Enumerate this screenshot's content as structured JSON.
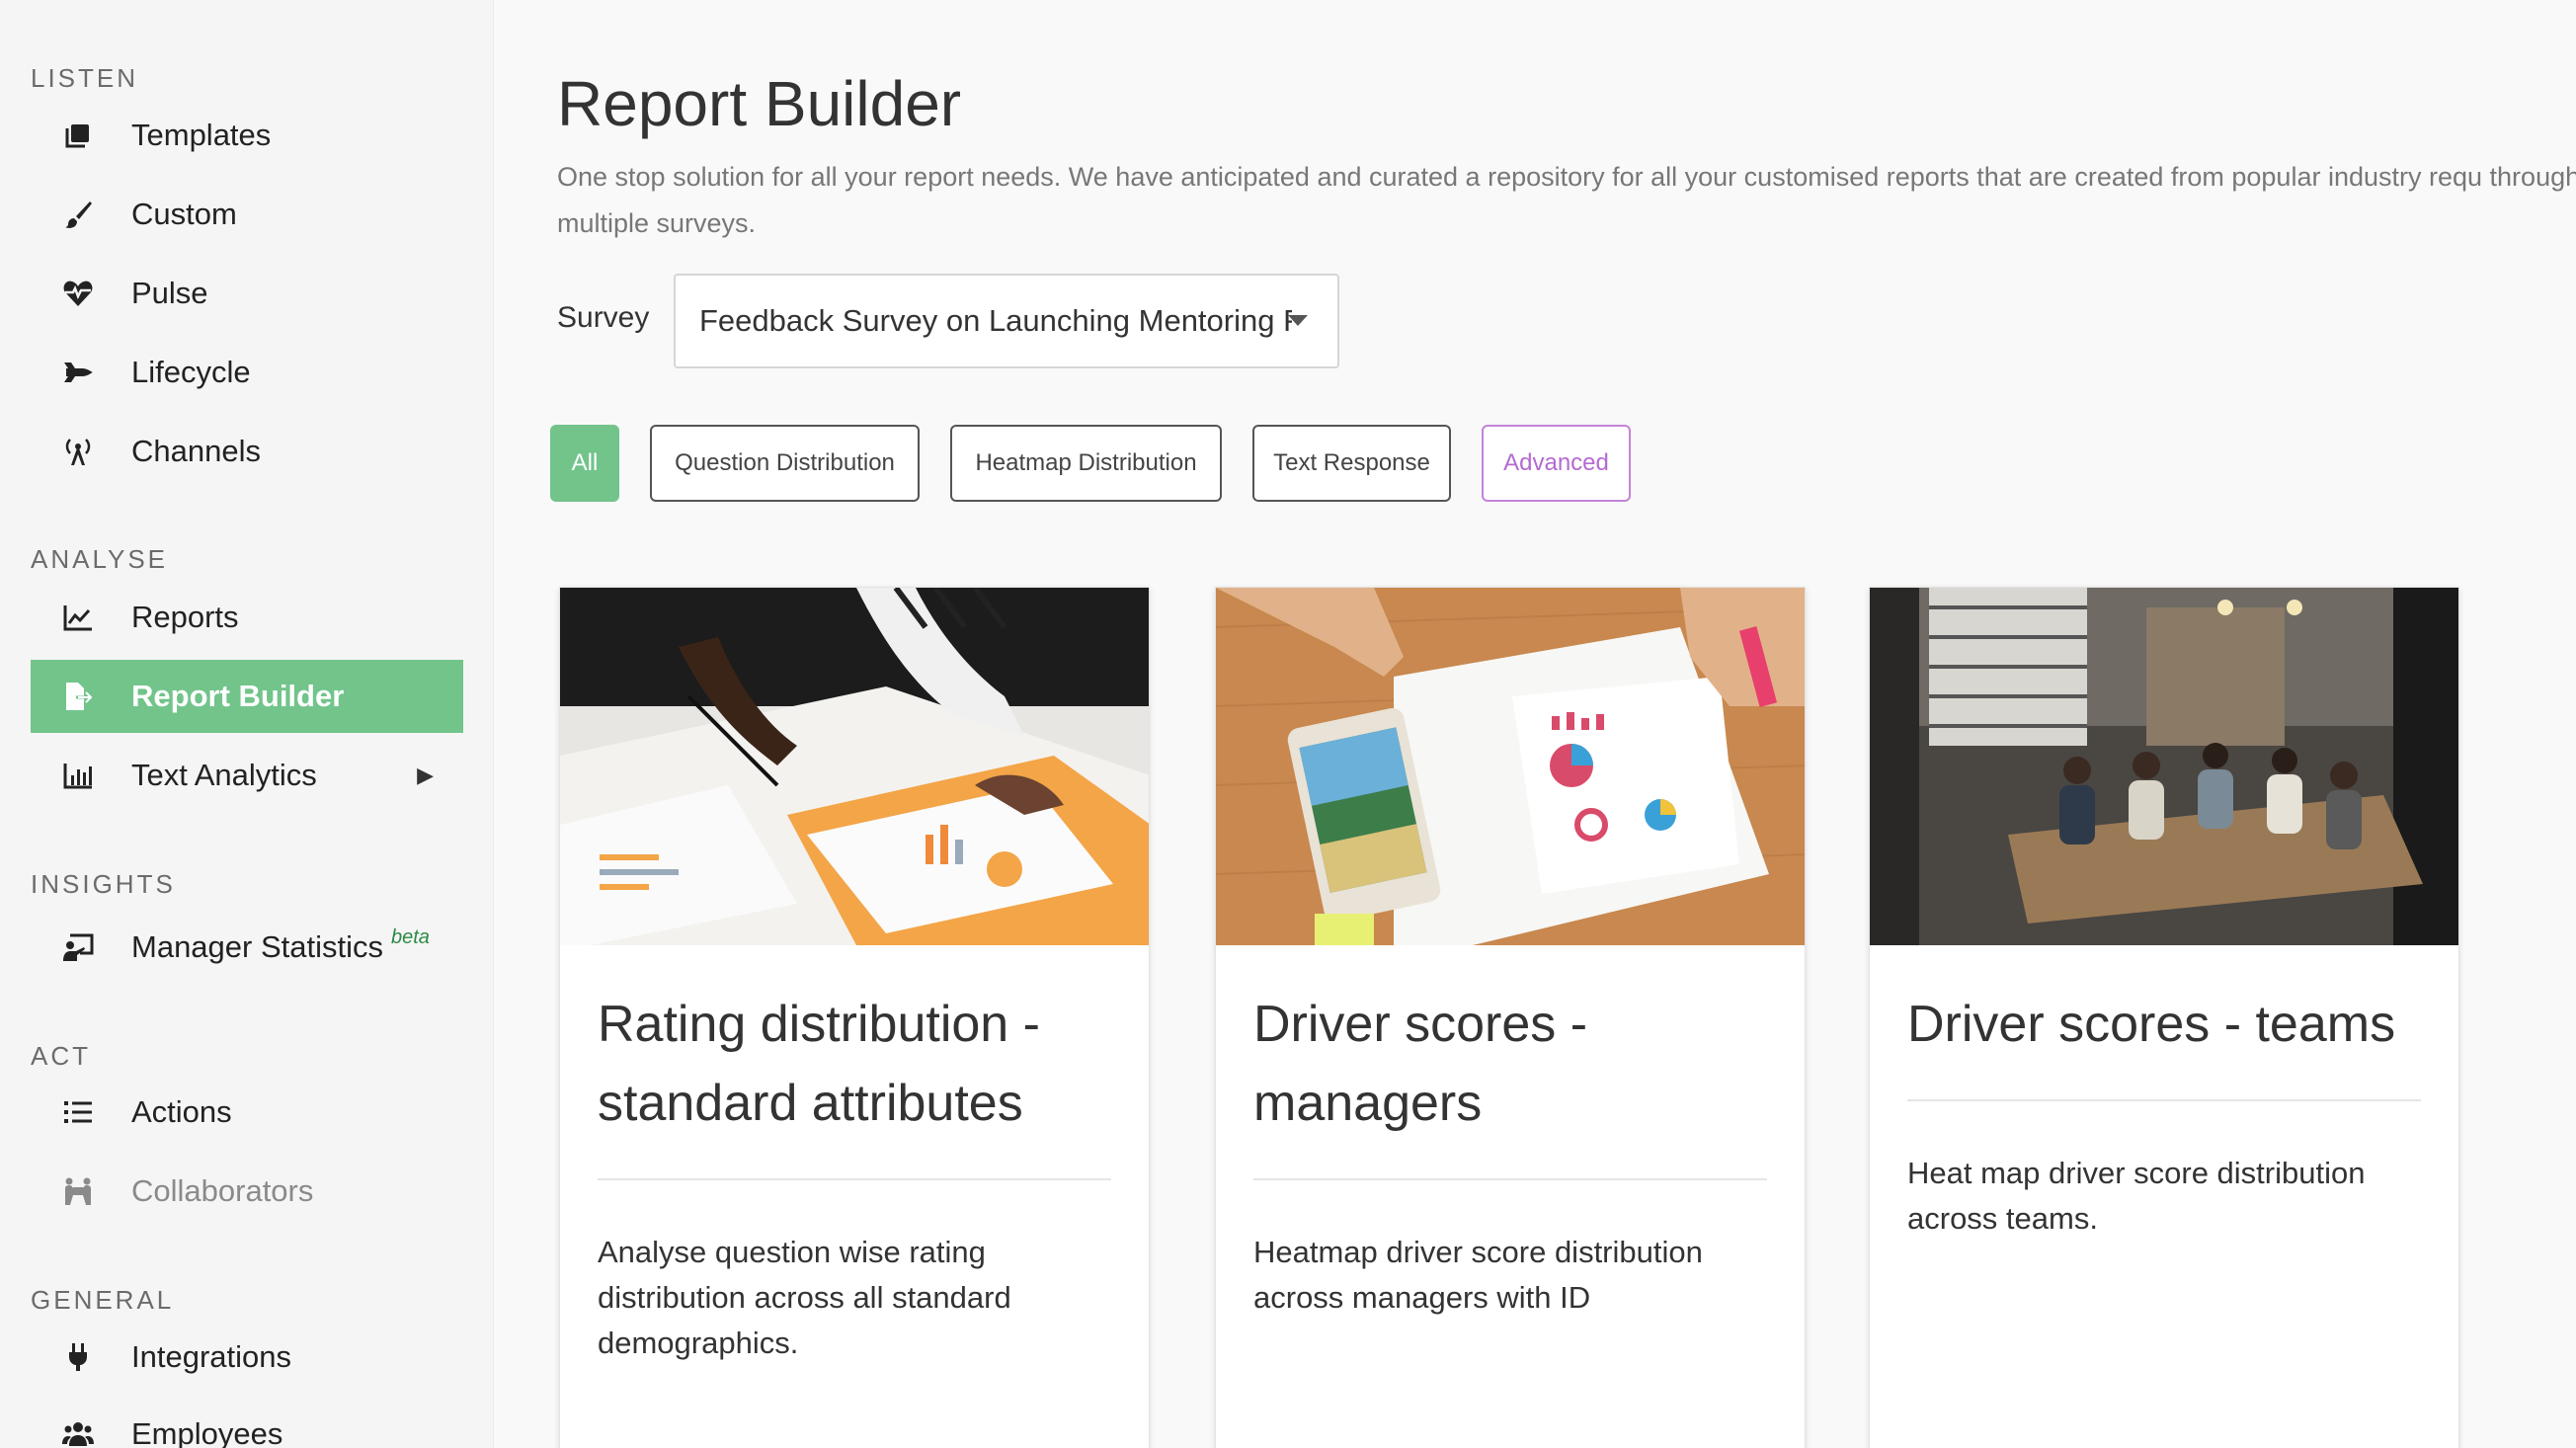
{
  "sidebar": {
    "sections": {
      "listen": "LISTEN",
      "analyse": "ANALYSE",
      "insights": "INSIGHTS",
      "act": "ACT",
      "general": "GENERAL"
    },
    "items": {
      "templates": "Templates",
      "custom": "Custom",
      "pulse": "Pulse",
      "lifecycle": "Lifecycle",
      "channels": "Channels",
      "reports": "Reports",
      "report_builder": "Report Builder",
      "text_analytics": "Text Analytics",
      "manager_statistics": "Manager Statistics",
      "manager_statistics_badge": "beta",
      "actions": "Actions",
      "collaborators": "Collaborators",
      "integrations": "Integrations",
      "employees": "Employees"
    },
    "active_item": "report_builder",
    "accent_color": "#72c48b"
  },
  "header": {
    "title": "Report Builder",
    "description": "One stop solution for all your report needs. We have anticipated and curated a repository for all your customised reports that are created from popular industry requ through multiple surveys."
  },
  "survey": {
    "label": "Survey",
    "selected": "Feedback Survey on Launching Mentoring P"
  },
  "filters": {
    "all": "All",
    "question_distribution": "Question Distribution",
    "heatmap_distribution": "Heatmap Distribution",
    "text_response": "Text Response",
    "advanced": "Advanced",
    "selected": "All",
    "advanced_color": "#b46ad0"
  },
  "cards": [
    {
      "title": "Rating distribution - standard attributes",
      "description": "Analyse question wise rating distribution across all standard demographics."
    },
    {
      "title": "Driver scores - managers",
      "description": "Heatmap driver score distribution across managers with ID"
    },
    {
      "title": "Driver scores - teams",
      "description": "Heat map driver score distribution across teams."
    }
  ]
}
